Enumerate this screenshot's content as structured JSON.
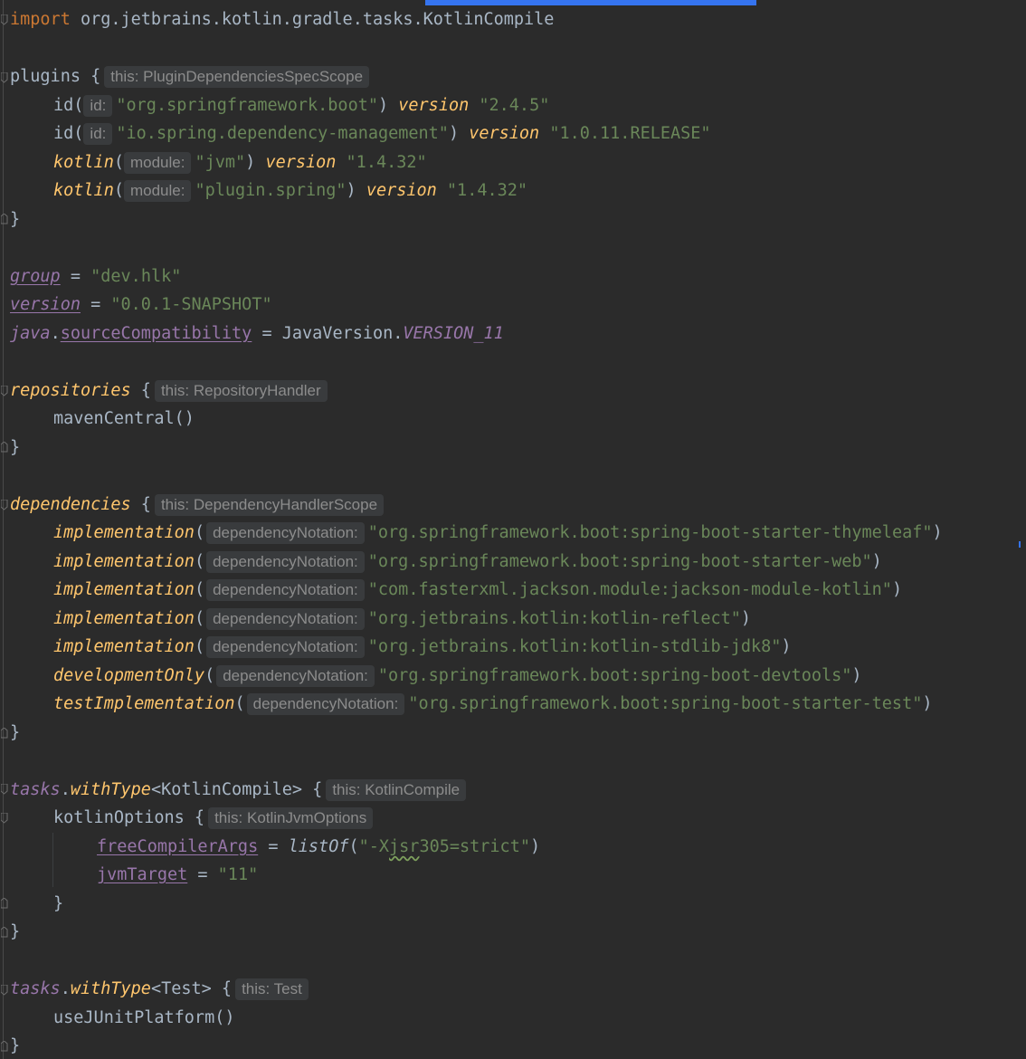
{
  "editor": {
    "hints": {
      "plugins_scope": "this: PluginDependenciesSpecScope",
      "id": "id:",
      "module": "module:",
      "repo_scope": "this: RepositoryHandler",
      "deps_scope": "this: DependencyHandlerScope",
      "dep_notation": "dependencyNotation:",
      "kotlin_compile": "this: KotlinCompile",
      "jvm_options": "this: KotlinJvmOptions",
      "test_scope": "this: Test"
    },
    "lines": {
      "import_kw": "import",
      "import_path": " org.jetbrains.kotlin.gradle.tasks.KotlinCompile",
      "plugins": "plugins {",
      "id": "id(",
      "boot_plugin": "\"org.springframework.boot\"",
      "dep_mgmt_plugin": "\"io.spring.dependency-management\"",
      "version_kw": "version",
      "boot_version": "\"2.4.5\"",
      "dep_mgmt_version": "\"1.0.11.RELEASE\"",
      "kotlin_fn": "kotlin",
      "jvm": "\"jvm\"",
      "plugin_spring": "\"plugin.spring\"",
      "kotlin_version": "\"1.4.32\"",
      "close_paren": ")",
      "close_brace": "}",
      "group_prop": "group",
      "group_val": "\"dev.hlk\"",
      "version_prop": "version",
      "version_val": "\"0.0.1-SNAPSHOT\"",
      "java_prop": "java",
      "source_compat": "sourceCompatibility",
      "java_version_cls": "JavaVersion.",
      "java_version_const": "VERSION_11",
      "repositories": "repositories",
      "maven_central": "mavenCentral()",
      "dependencies": "dependencies",
      "implementation": "implementation",
      "dev_only": "developmentOnly",
      "test_impl": "testImplementation",
      "dep_thymeleaf": "\"org.springframework.boot:spring-boot-starter-thymeleaf\"",
      "dep_web": "\"org.springframework.boot:spring-boot-starter-web\"",
      "dep_jackson": "\"com.fasterxml.jackson.module:jackson-module-kotlin\"",
      "dep_reflect": "\"org.jetbrains.kotlin:kotlin-reflect\"",
      "dep_stdlib": "\"org.jetbrains.kotlin:kotlin-stdlib-jdk8\"",
      "dep_devtools": "\"org.springframework.boot:spring-boot-devtools\"",
      "dep_test": "\"org.springframework.boot:spring-boot-starter-test\"",
      "tasks": "tasks",
      "with_type": "withType",
      "kotlin_compile_generic": "<KotlinCompile>",
      "test_generic": "<Test>",
      "kotlin_options": "kotlinOptions {",
      "free_compiler_args": "freeCompilerArgs",
      "list_of": "listOf",
      "xjsr_quote_open": "\"-X",
      "xjsr_squiggle": "jsr",
      "xjsr_rest": "305=strict\"",
      "jvm_target": "jvmTarget",
      "jvm_target_val": "\"11\"",
      "use_junit": "useJUnitPlatform()"
    }
  },
  "colors": {
    "background": "#2b2b2b",
    "keyword": "#cc7832",
    "string": "#6a8759",
    "function": "#ffc66d",
    "property": "#9876aa",
    "plain": "#a9b7c6",
    "hint_bg": "#393b3d",
    "hint_text": "#8c8c8c",
    "accent": "#3574f0"
  }
}
